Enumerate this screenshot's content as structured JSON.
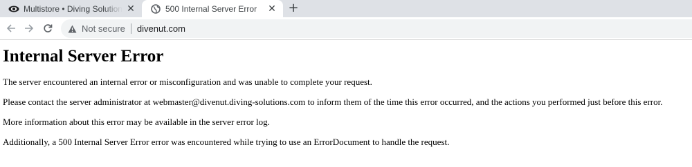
{
  "browser": {
    "tabs": [
      {
        "title": "Multistore • Diving Solutions (Asi",
        "favicon": "eye-icon",
        "active": false
      },
      {
        "title": "500 Internal Server Error",
        "favicon": "globe-icon",
        "active": true
      }
    ],
    "new_tab_label": "+",
    "close_label": "✕",
    "security_label": "Not secure",
    "url": "divenut.com"
  },
  "page": {
    "heading": "Internal Server Error",
    "paragraphs": [
      "The server encountered an internal error or misconfiguration and was unable to complete your request.",
      "Please contact the server administrator at webmaster@divenut.diving-solutions.com to inform them of the time this error occurred, and the actions you performed just before this error.",
      "More information about this error may be available in the server error log.",
      "Additionally, a 500 Internal Server Error error was encountered while trying to use an ErrorDocument to handle the request."
    ]
  },
  "colors": {
    "tabstrip_bg": "#dee1e6",
    "omnibox_bg": "#f1f3f4",
    "icon_gray": "#5f6368"
  }
}
